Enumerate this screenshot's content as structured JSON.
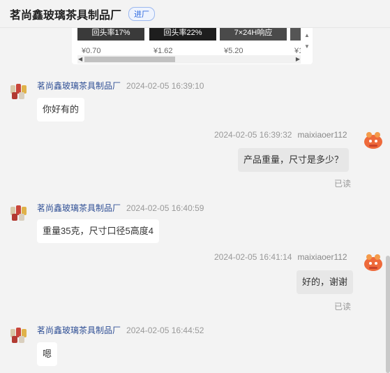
{
  "header": {
    "shop_name": "茗尚鑫玻璃茶具制品厂",
    "tag": "进厂"
  },
  "product_card": {
    "items": [
      {
        "badge": "回头率17%",
        "price": "¥0.70"
      },
      {
        "badge": "回头率22%",
        "price": "¥1.62"
      },
      {
        "badge": "7×24H响应",
        "price": "¥5.20"
      },
      {
        "badge": "",
        "price": "¥1"
      }
    ]
  },
  "messages": [
    {
      "side": "left",
      "name": "茗尚鑫玻璃茶具制品厂",
      "time": "2024-02-05 16:39:10",
      "text": "你好有的"
    },
    {
      "side": "right",
      "name": "maixiaoer112",
      "time": "2024-02-05 16:39:32",
      "text": "产品重量，尺寸是多少？",
      "status": "已读"
    },
    {
      "side": "left",
      "name": "茗尚鑫玻璃茶具制品厂",
      "time": "2024-02-05 16:40:59",
      "text": "重量35克，尺寸口径5高度4"
    },
    {
      "side": "right",
      "name": "maixiaoer112",
      "time": "2024-02-05 16:41:14",
      "text": "好的，谢谢",
      "status": "已读"
    },
    {
      "side": "left",
      "name": "茗尚鑫玻璃茶具制品厂",
      "time": "2024-02-05 16:44:52",
      "text": "嗯"
    }
  ],
  "colors": {
    "background": "#f3f3f3",
    "seller_name": "#2f4f95",
    "tag_blue": "#2d6ae0",
    "buyer_bubble": "#e7e7e7",
    "buyer_avatar": "#ee6a3b"
  }
}
